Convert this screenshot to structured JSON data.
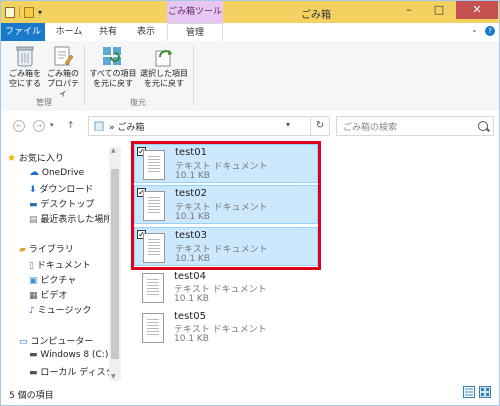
{
  "window": {
    "title": "ごみ箱",
    "context_tab": "ごみ箱ツール"
  },
  "tabs": {
    "file": "ファイル",
    "home": "ホーム",
    "share": "共有",
    "view": "表示",
    "manage": "管理"
  },
  "ribbon": {
    "empty_bin": [
      "ごみ箱を",
      "空にする"
    ],
    "bin_props": [
      "ごみ箱の",
      "プロパティ"
    ],
    "group_manage": "管理",
    "restore_all": [
      "すべての項目",
      "を元に戻す"
    ],
    "restore_selected": [
      "選択した項目",
      "を元に戻す"
    ],
    "group_restore": "復元"
  },
  "address": {
    "path": "ごみ箱",
    "search_placeholder": "ごみ箱の検索"
  },
  "nav": {
    "favorites": "お気に入り",
    "onedrive": "OneDrive",
    "downloads": "ダウンロード",
    "desktop": "デスクトップ",
    "recent": "最近表示した場所",
    "library": "ライブラリ",
    "documents": "ドキュメント",
    "pictures": "ピクチャ",
    "videos": "ビデオ",
    "music": "ミュージック",
    "computer": "コンピューター",
    "windows8": "Windows 8 (C:)",
    "localdisk": "ローカル ディスク (D"
  },
  "files": [
    {
      "name": "test01",
      "type": "テキスト ドキュメント",
      "size": "10.1 KB",
      "selected": true
    },
    {
      "name": "test02",
      "type": "テキスト ドキュメント",
      "size": "10.1 KB",
      "selected": true
    },
    {
      "name": "test03",
      "type": "テキスト ドキュメント",
      "size": "10.1 KB",
      "selected": true
    },
    {
      "name": "test04",
      "type": "テキスト ドキュメント",
      "size": "10.1 KB",
      "selected": false
    },
    {
      "name": "test05",
      "type": "テキスト ドキュメント",
      "size": "10.1 KB",
      "selected": false
    }
  ],
  "status": {
    "count": "5 個の項目"
  },
  "colors": {
    "title_bar": "#f3d262",
    "file_tab": "#1979ca",
    "selection": "#cce8ff",
    "highlight_box": "#e0001b",
    "context_tab": "#e8c6f2"
  }
}
